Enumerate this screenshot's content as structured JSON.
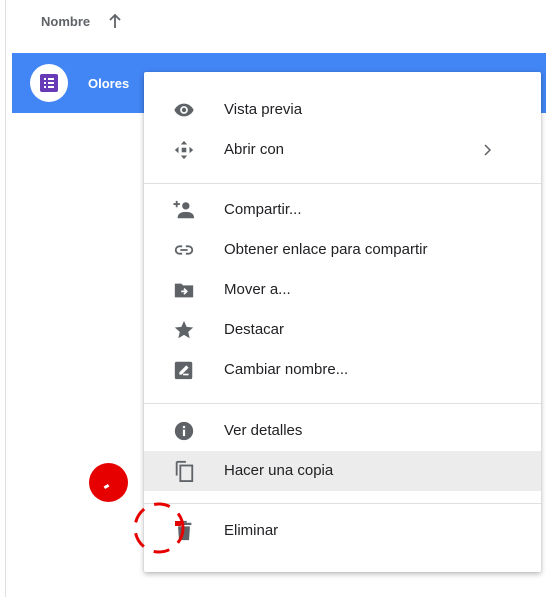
{
  "header": {
    "column_label": "Nombre"
  },
  "file": {
    "name": "Olores"
  },
  "menu": {
    "items": [
      {
        "label": "Vista previa",
        "icon": "eye-icon"
      },
      {
        "label": "Abrir con",
        "icon": "move-arrows-icon",
        "has_submenu": true
      },
      {
        "label": "Compartir...",
        "icon": "person-add-icon"
      },
      {
        "label": "Obtener enlace para compartir",
        "icon": "link-icon"
      },
      {
        "label": "Mover a...",
        "icon": "folder-move-icon"
      },
      {
        "label": "Destacar",
        "icon": "star-icon"
      },
      {
        "label": "Cambiar nombre...",
        "icon": "edit-box-icon"
      },
      {
        "label": "Ver detalles",
        "icon": "info-icon"
      },
      {
        "label": "Hacer una copia",
        "icon": "copy-icon",
        "highlighted": true
      },
      {
        "label": "Eliminar",
        "icon": "trash-icon"
      }
    ]
  },
  "colors": {
    "selection_blue": "#4285f4",
    "forms_purple": "#673ab7",
    "icon_gray": "#5f6368",
    "annotation_red": "#e60000",
    "hover_gray": "#ececec"
  }
}
